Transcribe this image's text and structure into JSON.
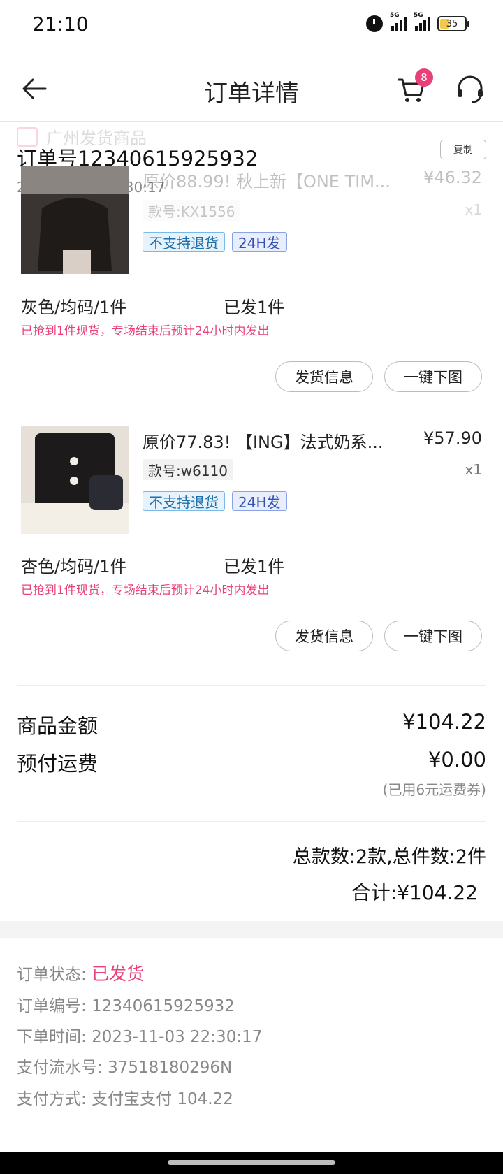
{
  "status_bar": {
    "time": "21:10",
    "icons": [
      "alarm-icon",
      "signal-5g-icon",
      "signal-5g-icon",
      "battery-icon"
    ],
    "network_label": "5G",
    "battery_level": "35"
  },
  "header": {
    "title": "订单详情",
    "cart_badge": "8"
  },
  "order": {
    "store_name": "广州发货商品",
    "number_label": "订单号12340615925932",
    "date": "2023-11-03 22:30:17",
    "copy_label": "复制"
  },
  "products": [
    {
      "name": "原价88.99! 秋上新【ONE TIM...",
      "price": "¥46.32",
      "code": "款号:KX1556",
      "qty": "x1",
      "tag_no_refund": "不支持退货",
      "tag_ship": "24H发",
      "spec": "灰色/均码/1件",
      "shipped": "已发1件",
      "note": "已抢到1件现货，专场结束后预计24小时内发出",
      "btn_ship_info": "发货信息",
      "btn_download": "一键下图"
    },
    {
      "name": "原价77.83! 【ING】法式奶系...",
      "price": "¥57.90",
      "code": "款号:w6110",
      "qty": "x1",
      "tag_no_refund": "不支持退货",
      "tag_ship": "24H发",
      "spec": "杏色/均码/1件",
      "shipped": "已发1件",
      "note": "已抢到1件现货，专场结束后预计24小时内发出",
      "btn_ship_info": "发货信息",
      "btn_download": "一键下图"
    }
  ],
  "amounts": {
    "goods_label": "商品金额",
    "goods_value": "¥104.22",
    "freight_label": "预付运费",
    "freight_value": "¥0.00",
    "freight_note": "(已用6元运费券)",
    "total_count": "总款数:2款,总件数:2件",
    "total_sum": "合计:¥104.22"
  },
  "info": {
    "status_label": "订单状态:",
    "status_value": "已发货",
    "number_label": "订单编号:",
    "number_value": "12340615925932",
    "time_label": "下单时间:",
    "time_value": "2023-11-03 22:30:17",
    "serial_label": "支付流水号:",
    "serial_value": "37518180296N",
    "pay_label": "支付方式:",
    "pay_value": "支付宝支付 104.22"
  },
  "colors": {
    "accent": "#e8417a",
    "tag_blue": "#1e6ea8",
    "tag_indigo": "#3451b2"
  }
}
